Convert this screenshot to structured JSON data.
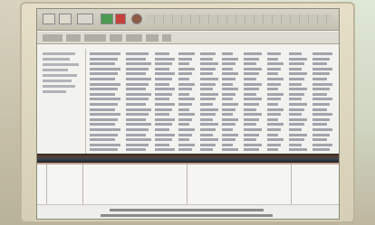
{
  "photo": {
    "subject": "monitor",
    "screen_app": {
      "toolbar": {
        "status_colors": {
          "go": "#4c9a52",
          "stop": "#c8403a",
          "record": "#8d5a45"
        }
      }
    }
  }
}
